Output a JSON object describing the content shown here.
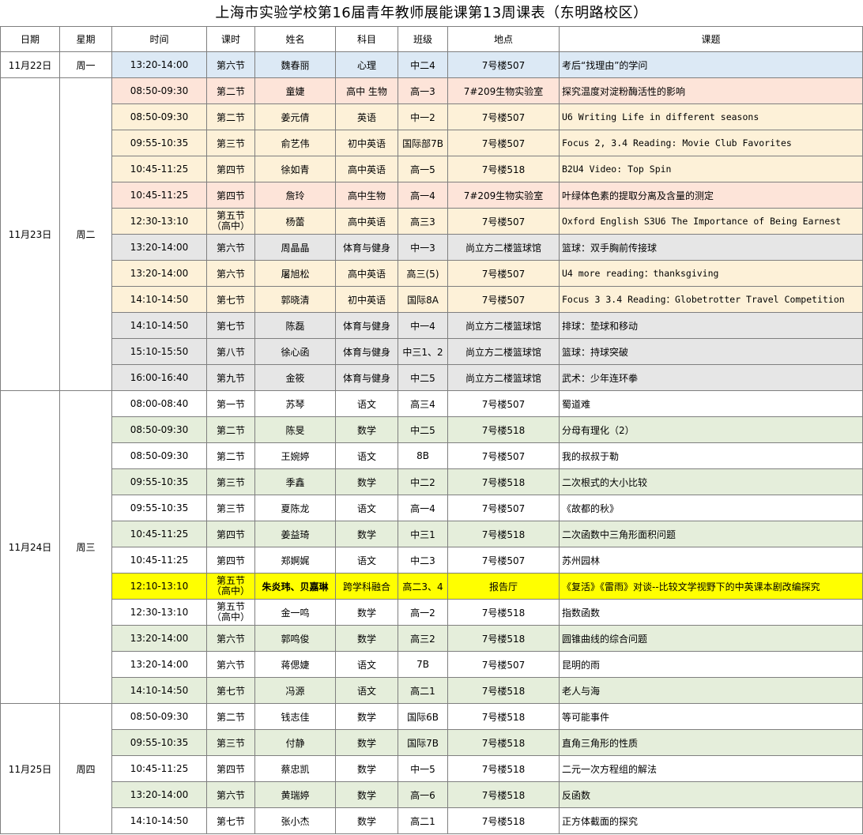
{
  "title": "上海市实验学校第16届青年教师展能课第13周课表（东明路校区）",
  "headers": [
    "日期",
    "星期",
    "时间",
    "课时",
    "姓名",
    "科目",
    "班级",
    "地点",
    "课题"
  ],
  "colors": {
    "blue": "#dce9f5",
    "pink": "#fde4d9",
    "orange": "#fdf1d8",
    "gray": "#e6e6e6",
    "green": "#e5eedb",
    "yellow": "#ffff00"
  },
  "rows": [
    {
      "date": "11月22日",
      "weekday": "周一",
      "span": 1,
      "color": "blue",
      "time": "13:20-14:00",
      "period": "第六节",
      "name": "魏春丽",
      "subject": "心理",
      "class": "中二4",
      "place": "7号楼507",
      "topic": "考后“找理由”的学问",
      "mono": false
    },
    {
      "date": "11月23日",
      "weekday": "周二",
      "span": 12,
      "color": "pink",
      "time": "08:50-09:30",
      "period": "第二节",
      "name": "童婕",
      "subject": "高中 生物",
      "class": "高一3",
      "place": "7#209生物实验室",
      "topic": "探究温度对淀粉酶活性的影响",
      "mono": false
    },
    {
      "color": "orange",
      "time": "08:50-09:30",
      "period": "第二节",
      "name": "姜元倩",
      "subject": "英语",
      "class": "中一2",
      "place": "7号楼507",
      "topic": "U6 Writing Life in different seasons",
      "mono": true
    },
    {
      "color": "orange",
      "time": "09:55-10:35",
      "period": "第三节",
      "name": "俞艺伟",
      "subject": "初中英语",
      "class": "国际部7B",
      "place": "7号楼507",
      "topic": "Focus 2, 3.4 Reading: Movie Club Favorites",
      "mono": true
    },
    {
      "color": "orange",
      "time": "10:45-11:25",
      "period": "第四节",
      "name": "徐如青",
      "subject": "高中英语",
      "class": "高一5",
      "place": "7号楼518",
      "topic": "B2U4  Video: Top Spin",
      "mono": true
    },
    {
      "color": "pink",
      "time": "10:45-11:25",
      "period": "第四节",
      "name": "詹玲",
      "subject": "高中生物",
      "class": "高一4",
      "place": "7#209生物实验室",
      "topic": "叶绿体色素的提取分离及含量的测定",
      "mono": false
    },
    {
      "color": "orange",
      "time": "12:30-13:10",
      "period": "第五节（高中）",
      "name": "杨蕾",
      "subject": "高中英语",
      "class": "高三3",
      "place": "7号楼507",
      "topic": "Oxford English S3U6 The Importance of Being Earnest",
      "mono": true
    },
    {
      "color": "gray",
      "time": "13:20-14:00",
      "period": "第六节",
      "name": "周晶晶",
      "subject": "体育与健身",
      "class": "中一3",
      "place": "尚立方二楼篮球馆",
      "topic": "篮球：双手胸前传接球",
      "mono": false
    },
    {
      "color": "orange",
      "time": "13:20-14:00",
      "period": "第六节",
      "name": "屠旭松",
      "subject": "高中英语",
      "class": "高三(5)",
      "place": "7号楼507",
      "topic": "U4 more reading：thanksgiving",
      "mono": true
    },
    {
      "color": "orange",
      "time": "14:10-14:50",
      "period": "第七节",
      "name": "郭晓清",
      "subject": "初中英语",
      "class": "国际8A",
      "place": "7号楼507",
      "topic": "Focus 3 3.4 Reading：Globetrotter Travel Competition",
      "mono": true
    },
    {
      "color": "gray",
      "time": "14:10-14:50",
      "period": "第七节",
      "name": "陈磊",
      "subject": "体育与健身",
      "class": "中一4",
      "place": "尚立方二楼篮球馆",
      "topic": "排球：垫球和移动",
      "mono": false
    },
    {
      "color": "gray",
      "time": "15:10-15:50",
      "period": "第八节",
      "name": "徐心函",
      "subject": "体育与健身",
      "class": "中三1、2",
      "place": "尚立方二楼篮球馆",
      "topic": "篮球：持球突破",
      "mono": false
    },
    {
      "color": "gray",
      "time": "16:00-16:40",
      "period": "第九节",
      "name": "金筱",
      "subject": "体育与健身",
      "class": "中二5",
      "place": "尚立方二楼篮球馆",
      "topic": "武术：少年连环拳",
      "mono": false
    },
    {
      "date": "11月24日",
      "weekday": "周三",
      "span": 12,
      "color": "white",
      "time": "08:00-08:40",
      "period": "第一节",
      "name": "苏琴",
      "subject": "语文",
      "class": "高三4",
      "place": "7号楼507",
      "topic": "蜀道难",
      "mono": false
    },
    {
      "color": "green",
      "time": "08:50-09:30",
      "period": "第二节",
      "name": "陈旻",
      "subject": "数学",
      "class": "中二5",
      "place": "7号楼518",
      "topic": "分母有理化（2）",
      "mono": false
    },
    {
      "color": "white",
      "time": "08:50-09:30",
      "period": "第二节",
      "name": "王婉婷",
      "subject": "语文",
      "class": "8B",
      "place": "7号楼507",
      "topic": "我的叔叔于勒",
      "mono": false
    },
    {
      "color": "green",
      "time": "09:55-10:35",
      "period": "第三节",
      "name": "季鑫",
      "subject": "数学",
      "class": "中二2",
      "place": "7号楼518",
      "topic": "二次根式的大小比较",
      "mono": false
    },
    {
      "color": "white",
      "time": "09:55-10:35",
      "period": "第三节",
      "name": "夏陈龙",
      "subject": "语文",
      "class": "高一4",
      "place": "7号楼507",
      "topic": "《故都的秋》",
      "mono": false
    },
    {
      "color": "green",
      "time": "10:45-11:25",
      "period": "第四节",
      "name": "姜益琦",
      "subject": "数学",
      "class": "中三1",
      "place": "7号楼518",
      "topic": "二次函数中三角形面积问题",
      "mono": false
    },
    {
      "color": "white",
      "time": "10:45-11:25",
      "period": "第四节",
      "name": "郑婀娓",
      "subject": "语文",
      "class": "中二3",
      "place": "7号楼507",
      "topic": "苏州园林",
      "mono": false
    },
    {
      "color": "yellow",
      "time": "12:10-13:10",
      "period": "第五节（高中）",
      "name": "朱炎玮、贝嘉琳",
      "subject": "跨学科融合",
      "class": "高二3、4",
      "place": "报告厅",
      "topic": "《复活》《雷雨》对谈--比较文学视野下的中英课本剧改编探究",
      "mono": false
    },
    {
      "color": "white",
      "time": "12:30-13:10",
      "period": "第五节（高中）",
      "name": "金一鸣",
      "subject": "数学",
      "class": "高一2",
      "place": "7号楼518",
      "topic": "指数函数",
      "mono": false
    },
    {
      "color": "green",
      "time": "13:20-14:00",
      "period": "第六节",
      "name": "郭鸣俊",
      "subject": "数学",
      "class": "高三2",
      "place": "7号楼518",
      "topic": "圆锥曲线的综合问题",
      "mono": false
    },
    {
      "color": "white",
      "time": "13:20-14:00",
      "period": "第六节",
      "name": "蒋偲婕",
      "subject": "语文",
      "class": "7B",
      "place": "7号楼507",
      "topic": "昆明的雨",
      "mono": false
    },
    {
      "color": "green",
      "time": "14:10-14:50",
      "period": "第七节",
      "name": "冯源",
      "subject": "语文",
      "class": "高二1",
      "place": "7号楼518",
      "topic": "老人与海",
      "mono": false
    },
    {
      "date": "11月25日",
      "weekday": "周四",
      "span": 5,
      "color": "white",
      "time": "08:50-09:30",
      "period": "第二节",
      "name": "钱志佳",
      "subject": "数学",
      "class": "国际6B",
      "place": "7号楼518",
      "topic": "等可能事件",
      "mono": false
    },
    {
      "color": "green",
      "time": "09:55-10:35",
      "period": "第三节",
      "name": "付静",
      "subject": "数学",
      "class": "国际7B",
      "place": "7号楼518",
      "topic": "直角三角形的性质",
      "mono": false
    },
    {
      "color": "white",
      "time": "10:45-11:25",
      "period": "第四节",
      "name": "蔡忠凯",
      "subject": "数学",
      "class": "中一5",
      "place": "7号楼518",
      "topic": "二元一次方程组的解法",
      "mono": false
    },
    {
      "color": "green",
      "time": "13:20-14:00",
      "period": "第六节",
      "name": "黄瑞婷",
      "subject": "数学",
      "class": "高一6",
      "place": "7号楼518",
      "topic": "反函数",
      "mono": false
    },
    {
      "color": "white",
      "time": "14:10-14:50",
      "period": "第七节",
      "name": "张小杰",
      "subject": "数学",
      "class": "高二1",
      "place": "7号楼518",
      "topic": "正方体截面的探究",
      "mono": false
    }
  ]
}
